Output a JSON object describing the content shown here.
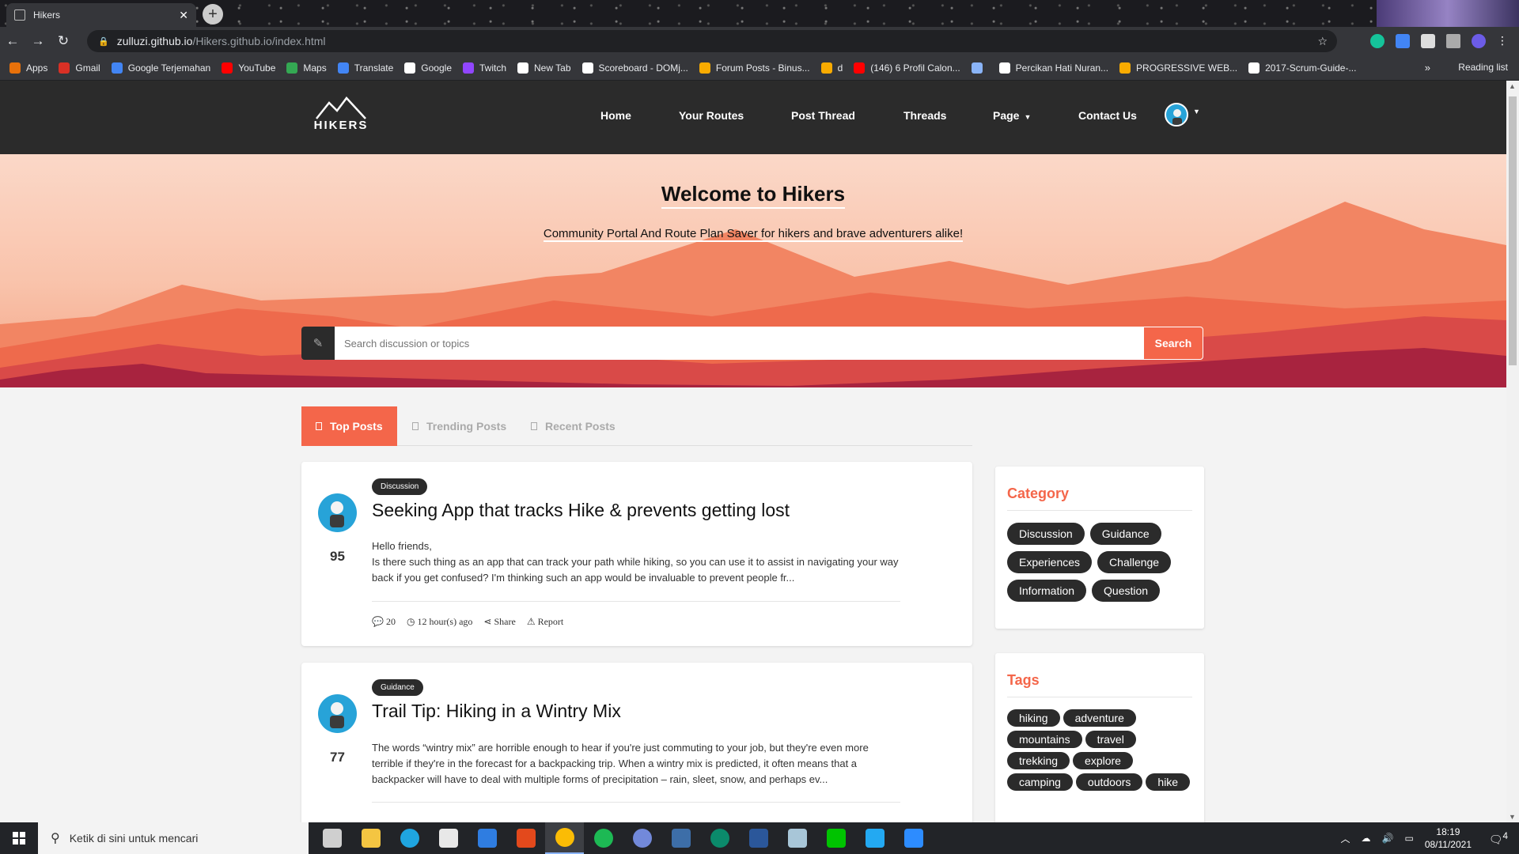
{
  "browser": {
    "tab_title": "Hikers",
    "url_host": "zulluzi.github.io",
    "url_path": "/Hikers.github.io/index.html",
    "bookmarks": [
      {
        "label": "Apps",
        "color": "#e8710a"
      },
      {
        "label": "Gmail",
        "color": "#d93025"
      },
      {
        "label": "Google Terjemahan",
        "color": "#4285f4"
      },
      {
        "label": "YouTube",
        "color": "#ff0000"
      },
      {
        "label": "Maps",
        "color": "#34a853"
      },
      {
        "label": "Translate",
        "color": "#4285f4"
      },
      {
        "label": "Google",
        "color": "#ffffff"
      },
      {
        "label": "Twitch",
        "color": "#9146ff"
      },
      {
        "label": "New Tab",
        "color": "#ffffff"
      },
      {
        "label": "Scoreboard - DOMj...",
        "color": "#ffffff"
      },
      {
        "label": "Forum Posts - Binus...",
        "color": "#f9ab00"
      },
      {
        "label": "d",
        "color": "#f9ab00"
      },
      {
        "label": "(146) 6 Profil Calon...",
        "color": "#ff0000"
      },
      {
        "label": "",
        "color": "#8ab4f8"
      },
      {
        "label": "Percikan Hati Nuran...",
        "color": "#ffffff"
      },
      {
        "label": "PROGRESSIVE WEB...",
        "color": "#f9ab00"
      },
      {
        "label": "2017-Scrum-Guide-...",
        "color": "#ffffff"
      }
    ],
    "reading_list": "Reading list",
    "more": "»"
  },
  "nav": {
    "logo_text": "HIKERS",
    "items": [
      "Home",
      "Your Routes",
      "Post Thread",
      "Threads",
      "Page",
      "Contact Us"
    ]
  },
  "hero": {
    "title": "Welcome to Hikers",
    "subtitle": "Community Portal And Route Plan Saver for hikers and brave adventurers alike!",
    "search_placeholder": "Search discussion or topics",
    "search_button": "Search"
  },
  "tabs": [
    "Top Posts",
    "Trending Posts",
    "Recent Posts"
  ],
  "posts": [
    {
      "category": "Discussion",
      "title": "Seeking App that tracks Hike & prevents getting lost",
      "score": "95",
      "body_line1": "Hello friends,",
      "body_line2": "Is there such thing as an app that can track your path while hiking, so you can use it to assist in navigating your way back if you get confused? I'm thinking such an app would be invaluable to prevent people fr...",
      "comments": "20",
      "time": "12 hour(s) ago",
      "share": "Share",
      "report": "Report"
    },
    {
      "category": "Guidance",
      "title": "Trail Tip: Hiking in a Wintry Mix",
      "score": "77",
      "body_line1": "",
      "body_line2": "The words “wintry mix” are horrible enough to hear if you're just commuting to your job, but they're even more terrible if they're in the forecast for a backpacking trip. When a wintry mix is predicted, it often means that a backpacker will have to deal with multiple forms of precipitation – rain, sleet, snow, and perhaps ev..."
    }
  ],
  "sidebar": {
    "category_title": "Category",
    "categories": [
      "Discussion",
      "Guidance",
      "Experiences",
      "Challenge",
      "Information",
      "Question"
    ],
    "tags_title": "Tags",
    "tags": [
      "hiking",
      "adventure",
      "mountains",
      "travel",
      "trekking",
      "explore",
      "camping",
      "outdoors",
      "hike"
    ]
  },
  "taskbar": {
    "search_placeholder": "Ketik di sini untuk mencari",
    "time": "18:19",
    "date": "08/11/2021",
    "notifications": "4",
    "apps": [
      {
        "name": "task-view",
        "color": "#cfcfcf"
      },
      {
        "name": "file-explorer",
        "color": "#f4c542"
      },
      {
        "name": "edge",
        "color": "#1fa5e0"
      },
      {
        "name": "store",
        "color": "#e8e8e8"
      },
      {
        "name": "mail",
        "color": "#2f7de1"
      },
      {
        "name": "office",
        "color": "#e3491c"
      },
      {
        "name": "chrome",
        "color": "#fbbc05"
      },
      {
        "name": "spotify",
        "color": "#1db954"
      },
      {
        "name": "discord",
        "color": "#7289da"
      },
      {
        "name": "steam",
        "color": "#3d6ea8"
      },
      {
        "name": "edge-dev",
        "color": "#0b8a6b"
      },
      {
        "name": "word",
        "color": "#2b579a"
      },
      {
        "name": "notepad",
        "color": "#a8c6d8"
      },
      {
        "name": "line",
        "color": "#00c300"
      },
      {
        "name": "vscode",
        "color": "#23a9f2"
      },
      {
        "name": "zoom",
        "color": "#2d8cff"
      }
    ]
  },
  "colors": {
    "accent": "#f4664a",
    "dark": "#2b2b2b"
  }
}
